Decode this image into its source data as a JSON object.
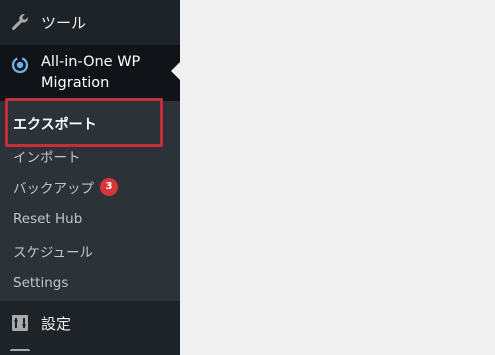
{
  "sidebar": {
    "tools": {
      "label": "ツール",
      "icon": "wrench-icon"
    },
    "all_in_one": {
      "label_line1": "All-in-One WP",
      "label_line2": "Migration",
      "icon": "migration-icon"
    },
    "submenu": [
      {
        "label": "エクスポート",
        "current": true
      },
      {
        "label": "インポート",
        "current": false
      },
      {
        "label": "バックアップ",
        "badge": "3",
        "current": false
      },
      {
        "label": "Reset Hub",
        "current": false
      },
      {
        "label": "スケジュール",
        "current": false
      },
      {
        "label": "Settings",
        "current": false
      }
    ],
    "settings": {
      "label": "設定",
      "icon": "settings-icon"
    }
  },
  "colors": {
    "sidebar_bg": "#1d2327",
    "submenu_bg": "#2c3338",
    "active_bg": "#101418",
    "highlight": "#c62f3a",
    "badge": "#d63638",
    "content_bg": "#f0f0f1"
  }
}
